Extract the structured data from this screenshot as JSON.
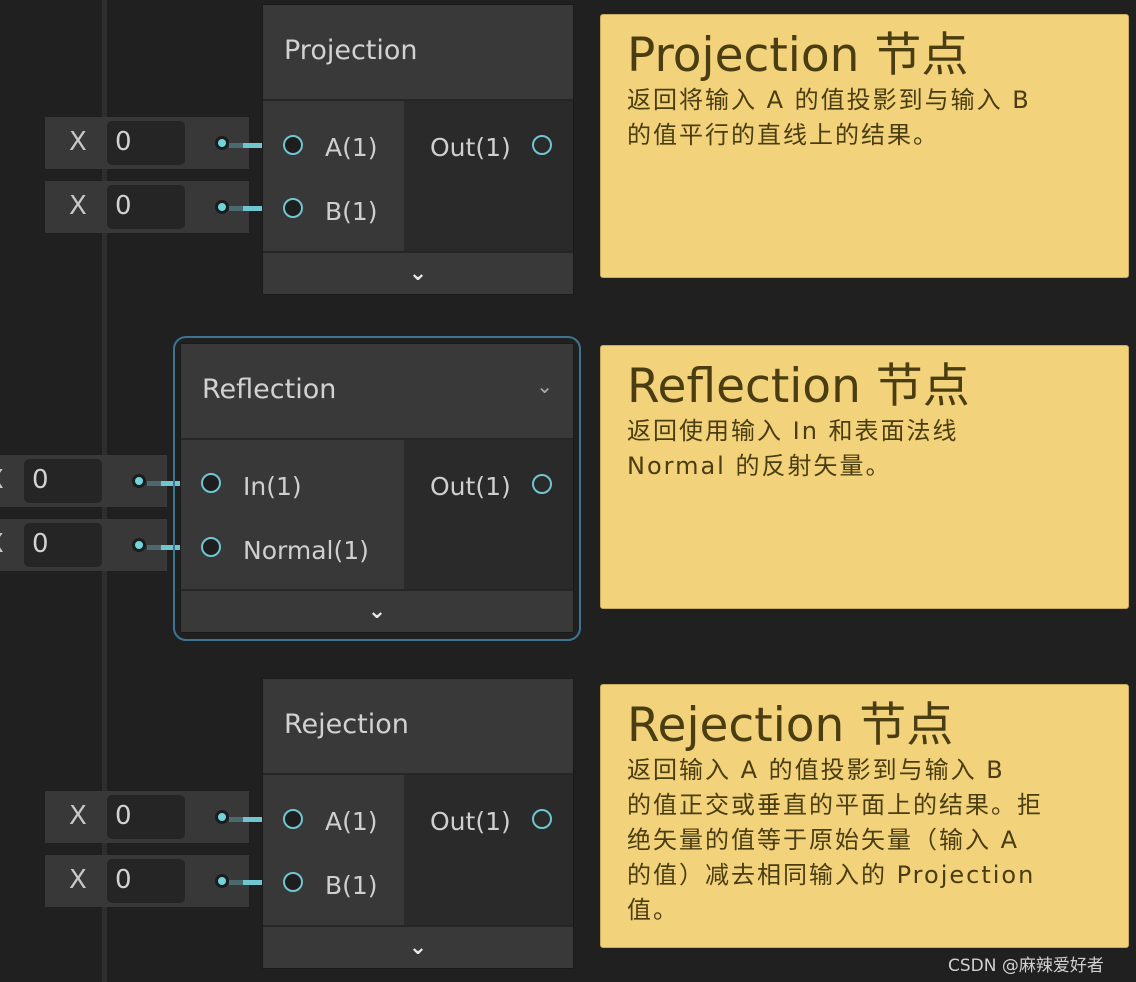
{
  "nodes": [
    {
      "title": "Projection",
      "inputs": [
        {
          "label": "A(1)",
          "field_label": "X",
          "value": "0"
        },
        {
          "label": "B(1)",
          "field_label": "X",
          "value": "0"
        }
      ],
      "output": "Out(1)"
    },
    {
      "title": "Reflection",
      "selected": true,
      "inputs": [
        {
          "label": "In(1)",
          "field_label": "X",
          "value": "0"
        },
        {
          "label": "Normal(1)",
          "field_label": "X",
          "value": "0"
        }
      ],
      "output": "Out(1)"
    },
    {
      "title": "Rejection",
      "inputs": [
        {
          "label": "A(1)",
          "field_label": "X",
          "value": "0"
        },
        {
          "label": "B(1)",
          "field_label": "X",
          "value": "0"
        }
      ],
      "output": "Out(1)"
    }
  ],
  "notes": [
    {
      "title": "Projection 节点",
      "body": "返回将输入 A 的值投影到与输入 B\n的值平行的直线上的结果。"
    },
    {
      "title": "Reflection 节点",
      "body": "返回使用输入 In 和表面法线\nNormal 的反射矢量。"
    },
    {
      "title": "Rejection 节点",
      "body": "返回输入 A 的值投影到与输入 B\n的值正交或垂直的平面上的结果。拒\n绝矢量的值等于原始矢量（输入 A\n的值）减去相同输入的 Projection\n值。"
    }
  ],
  "colors": {
    "note": "#f2d27a",
    "port": "#6fc6d0",
    "selection": "#3d7591",
    "background": "#202020"
  },
  "watermark": "CSDN @麻辣爱好者"
}
